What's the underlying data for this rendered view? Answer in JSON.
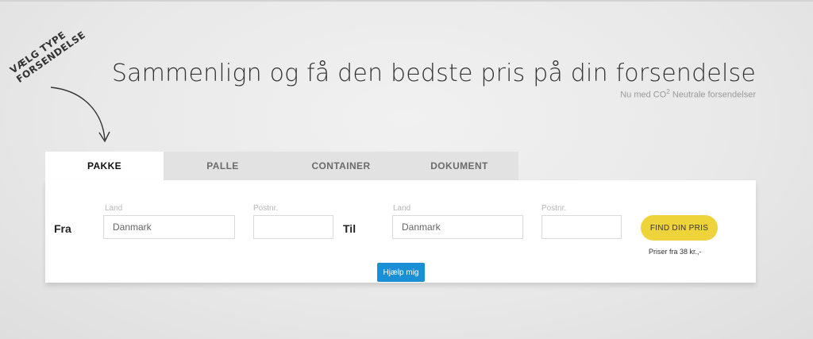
{
  "hint": {
    "line1": "VÆLG TYPE",
    "line2": "FORSENDELSE"
  },
  "header": {
    "headline": "Sammenlign og få den bedste pris på din forsendelse",
    "sub_prefix": "Nu med CO",
    "sub_sup": "2",
    "sub_suffix": " Neutrale forsendelser"
  },
  "tabs": [
    {
      "label": "PAKKE",
      "active": true
    },
    {
      "label": "PALLE",
      "active": false
    },
    {
      "label": "CONTAINER",
      "active": false
    },
    {
      "label": "DOKUMENT",
      "active": false
    }
  ],
  "form": {
    "from_label": "Fra",
    "to_label": "Til",
    "country_label": "Land",
    "postal_label": "Postnr.",
    "from_country": "Danmark",
    "from_postal": "",
    "to_country": "Danmark",
    "to_postal": "",
    "find_price_label": "FIND DIN PRIS",
    "price_note": "Priser fra 38 kr.,-",
    "help_label": "Hjælp mig"
  },
  "colors": {
    "accent_yellow": "#efd33b",
    "help_blue": "#1a8fd6"
  }
}
